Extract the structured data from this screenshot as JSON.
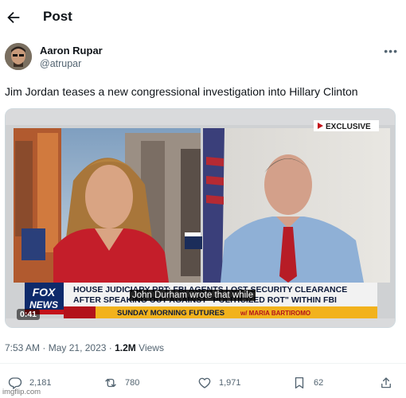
{
  "header": {
    "title": "Post"
  },
  "author": {
    "name": "Aaron Rupar",
    "handle": "@atrupar"
  },
  "tweet": {
    "text": "Jim Jordan teases a new congressional investigation into Hillary Clinton"
  },
  "video": {
    "badge": "EXCLUSIVE",
    "logo_line1": "FOX",
    "logo_line2": "NEWS",
    "chyron_line1": "HOUSE JUDICIARY RPT: FBI AGENTS LOST SECURITY CLEARANCE",
    "chyron_line2": "AFTER SPEAKING OUT AGAINST \"POLITICIZED ROT\" WITHIN FBI",
    "show_name": "SUNDAY MORNING FUTURES",
    "show_host": "w/ MARIA BARTIROMO",
    "time": "0:41",
    "subtitle": "John Durham wrote that while"
  },
  "meta": {
    "time": "7:53 AM",
    "sep": "·",
    "date": "May 21, 2023",
    "views_count": "1.2M",
    "views_label": "Views"
  },
  "actions": {
    "replies": "2,181",
    "reposts": "780",
    "likes": "1,971",
    "bookmarks": "62"
  },
  "watermark": "imgflip.com",
  "colors": {
    "text": "#0f1419",
    "secondary": "#536471",
    "fox_red": "#b3121b",
    "chyron_blue": "#1b2d5a",
    "ticker_yellow": "#f2b21c"
  },
  "icons": [
    "back-arrow-icon",
    "more-icon",
    "reply-icon",
    "repost-icon",
    "like-icon",
    "bookmark-icon",
    "share-icon"
  ]
}
